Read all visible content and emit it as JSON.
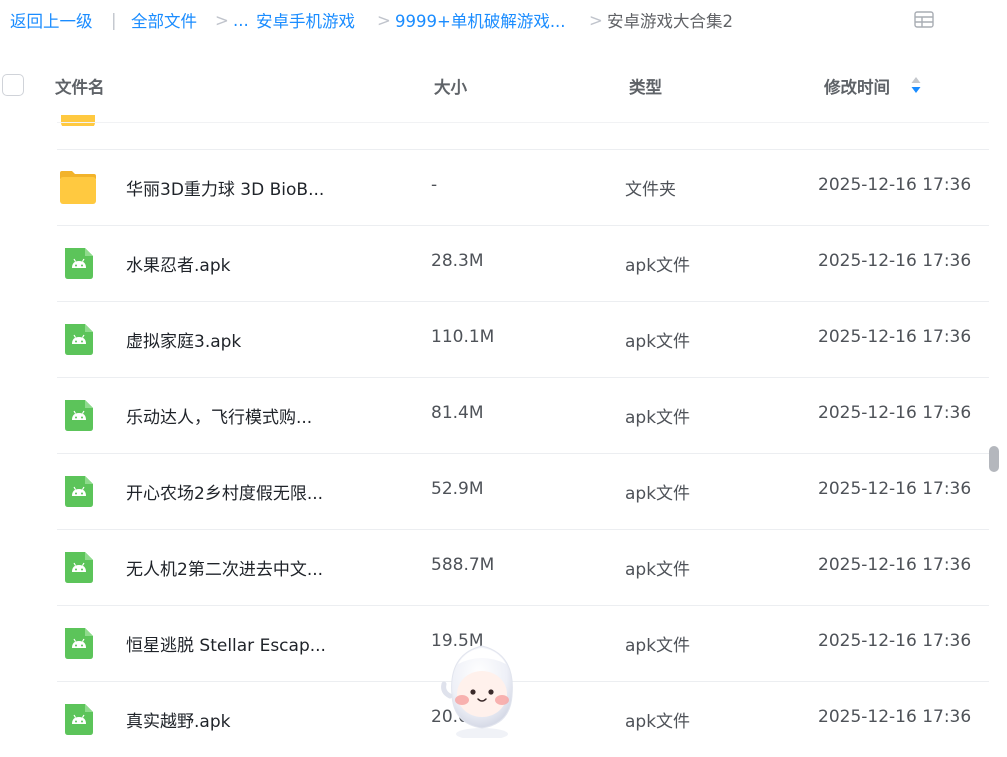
{
  "breadcrumb": {
    "back": "返回上一级",
    "sep_bar": "|",
    "all_files": "全部文件",
    "sep": ">",
    "ellipsis": "...",
    "android_games": "安卓手机游戏",
    "crack_games": "9999+单机破解游戏...",
    "current": "安卓游戏大合集2"
  },
  "header": {
    "name": "文件名",
    "size": "大小",
    "type": "类型",
    "modified": "修改时间"
  },
  "files": [
    {
      "name": "华丽3D重力球 3D BioB...",
      "size": "-",
      "type": "文件夹",
      "time": "2025-12-16 17:36",
      "icon": "folder-icon"
    },
    {
      "name": "水果忍者.apk",
      "size": "28.3M",
      "type": "apk文件",
      "time": "2025-12-16 17:36",
      "icon": "apk-icon"
    },
    {
      "name": "虚拟家庭3.apk",
      "size": "110.1M",
      "type": "apk文件",
      "time": "2025-12-16 17:36",
      "icon": "apk-icon"
    },
    {
      "name": "乐动达人，飞行模式购...",
      "size": "81.4M",
      "type": "apk文件",
      "time": "2025-12-16 17:36",
      "icon": "apk-icon"
    },
    {
      "name": "开心农场2乡村度假无限...",
      "size": "52.9M",
      "type": "apk文件",
      "time": "2025-12-16 17:36",
      "icon": "apk-icon"
    },
    {
      "name": "无人机2第二次进去中文...",
      "size": "588.7M",
      "type": "apk文件",
      "time": "2025-12-16 17:36",
      "icon": "apk-icon"
    },
    {
      "name": "恒星逃脱 Stellar Escap...",
      "size": "19.5M",
      "type": "apk文件",
      "time": "2025-12-16 17:36",
      "icon": "apk-icon"
    },
    {
      "name": "真实越野.apk",
      "size": "20.6M",
      "type": "apk文件",
      "time": "2025-12-16 17:36",
      "icon": "apk-icon"
    }
  ],
  "colors": {
    "link": "#1a8cff",
    "folder": "#ffc940",
    "apk": "#5cc45a",
    "sort_active": "#1a8cff"
  }
}
